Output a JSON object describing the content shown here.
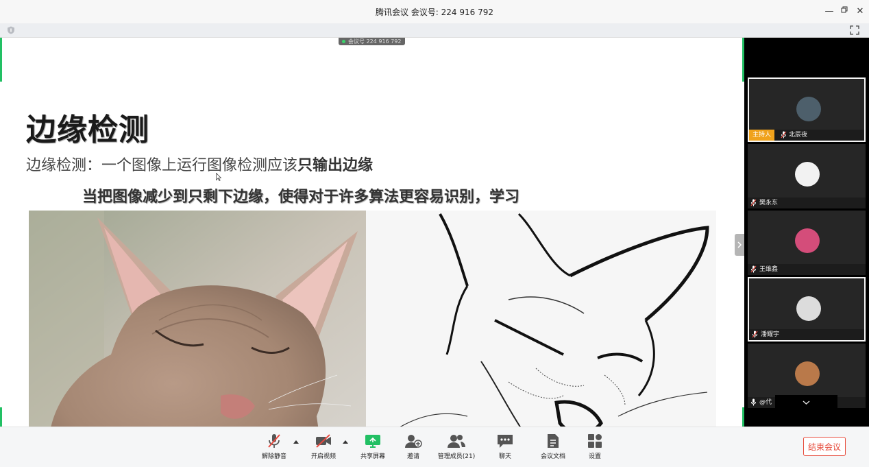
{
  "window": {
    "title": "腾讯会议 会议号: 224 916 792"
  },
  "share": {
    "meeting_tag": "会议号 224 916 792",
    "slide": {
      "title": "边缘检测",
      "line1_prefix": "边缘检测：一个图像上运行图像检测应该",
      "line1_bold": "只输出边缘",
      "line2": "当把图像减少到只剩下边缘，使得对于许多算法更容易识别，学习"
    }
  },
  "participants": [
    {
      "name": "北辰夜",
      "role": "主持人",
      "avatar_color": "#4d5f6b"
    },
    {
      "name": "樊永东",
      "avatar_color": "#f2f2f2"
    },
    {
      "name": "王维鑫",
      "avatar_color": "#d44d7a"
    },
    {
      "name": "潘耀宇",
      "avatar_color": "#dcdcdc"
    },
    {
      "name": "@代",
      "avatar_color": "#b9794a"
    }
  ],
  "toolbar": {
    "unmute": "解除静音",
    "start_video": "开启视频",
    "share_screen": "共享屏幕",
    "invite": "邀请",
    "manage_members": "管理成员(21)",
    "chat": "聊天",
    "meeting_docs": "会议文档",
    "settings": "设置",
    "end_meeting": "结束会议"
  },
  "colors": {
    "accent": "#22c064",
    "end_red": "#e74c3c",
    "host_orange": "#f0a21b"
  }
}
